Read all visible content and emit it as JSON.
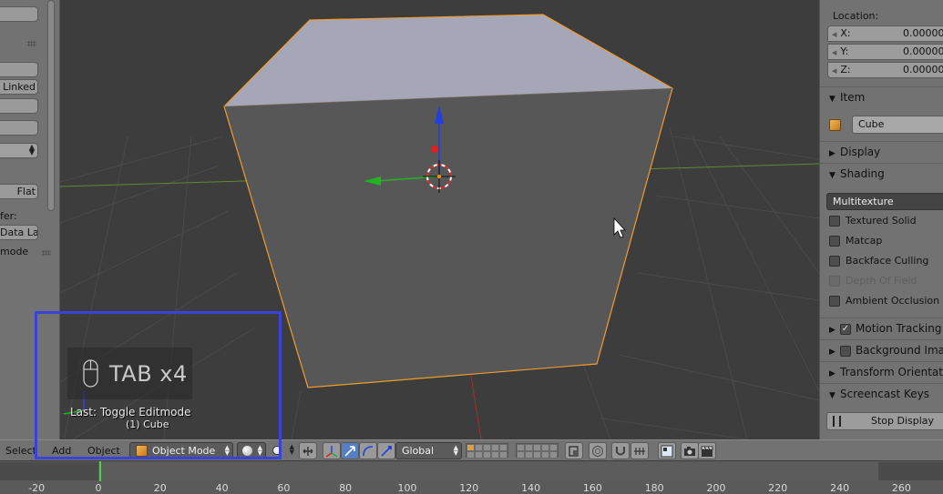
{
  "tool_shelf": {
    "linked_label": "Linked",
    "flat_label": "Flat",
    "data_label_prefix": "fer:",
    "data_layer_label": "Data La",
    "mode_label": "mode"
  },
  "viewport": {
    "screencast_key": "TAB x4",
    "last_operator": "Last: Toggle Editmode",
    "active_object": "(1) Cube"
  },
  "properties": {
    "location_label": "Location:",
    "location": [
      {
        "axis": "X:",
        "value": "0.00000"
      },
      {
        "axis": "Y:",
        "value": "0.00000"
      },
      {
        "axis": "Z:",
        "value": "0.00000"
      }
    ],
    "item_header": "Item",
    "object_name": "Cube",
    "display_header": "Display",
    "shading_header": "Shading",
    "shading_mode": "Multitexture",
    "shading_options": [
      {
        "label": "Textured Solid",
        "checked": false,
        "enabled": true
      },
      {
        "label": "Matcap",
        "checked": false,
        "enabled": true
      },
      {
        "label": "Backface Culling",
        "checked": false,
        "enabled": true
      },
      {
        "label": "Depth Of Field",
        "checked": false,
        "enabled": false
      },
      {
        "label": "Ambient Occlusion",
        "checked": false,
        "enabled": true
      }
    ],
    "motion_tracking_header": "Motion Tracking",
    "background_images_header": "Background Images",
    "transform_orientations_header": "Transform Orientations",
    "screencast_keys_header": "Screencast Keys",
    "stop_display_label": "Stop Display"
  },
  "header": {
    "menu_select": "Select",
    "menu_add": "Add",
    "menu_object": "Object",
    "mode": "Object Mode",
    "orientation": "Global"
  },
  "timeline": {
    "frame_labels": [
      "-20",
      "0",
      "20",
      "40",
      "60",
      "80",
      "100",
      "120",
      "140",
      "160",
      "180",
      "200",
      "220",
      "240",
      "260"
    ],
    "current_frame": 1
  },
  "colors": {
    "selection_outline": "#f29b2a",
    "highlight_box": "#3a43d9",
    "x_axis": "#a03030",
    "y_axis": "#6ea23a",
    "gizmo_z": "#1f3fe0",
    "gizmo_y": "#1fb51f",
    "gizmo_x": "#e01f1f"
  }
}
